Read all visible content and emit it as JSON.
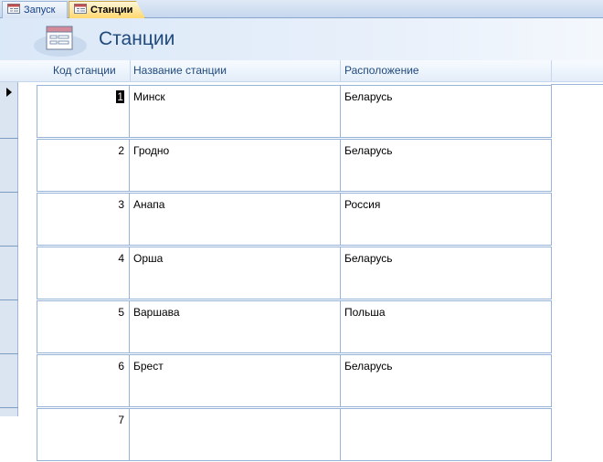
{
  "tabs": [
    {
      "label": "Запуск",
      "active": false,
      "icon": "form-icon"
    },
    {
      "label": "Станции",
      "active": true,
      "icon": "form-icon"
    }
  ],
  "form": {
    "title": "Станции",
    "icon": "form-large-icon"
  },
  "columns": [
    "Код станции",
    "Название станции",
    "Расположение"
  ],
  "records": [
    {
      "code": "1",
      "name": "Минск",
      "location": "Беларусь"
    },
    {
      "code": "2",
      "name": "Гродно",
      "location": "Беларусь"
    },
    {
      "code": "3",
      "name": "Анапа",
      "location": "Россия"
    },
    {
      "code": "4",
      "name": "Орша",
      "location": "Беларусь"
    },
    {
      "code": "5",
      "name": "Варшава",
      "location": "Польша"
    },
    {
      "code": "6",
      "name": "Брест",
      "location": "Беларусь"
    },
    {
      "code": "7",
      "name": "",
      "location": ""
    }
  ],
  "colors": {
    "accent": "#1f497d",
    "active_tab": "#ffd86e",
    "grid_border": "#97b3d8"
  }
}
